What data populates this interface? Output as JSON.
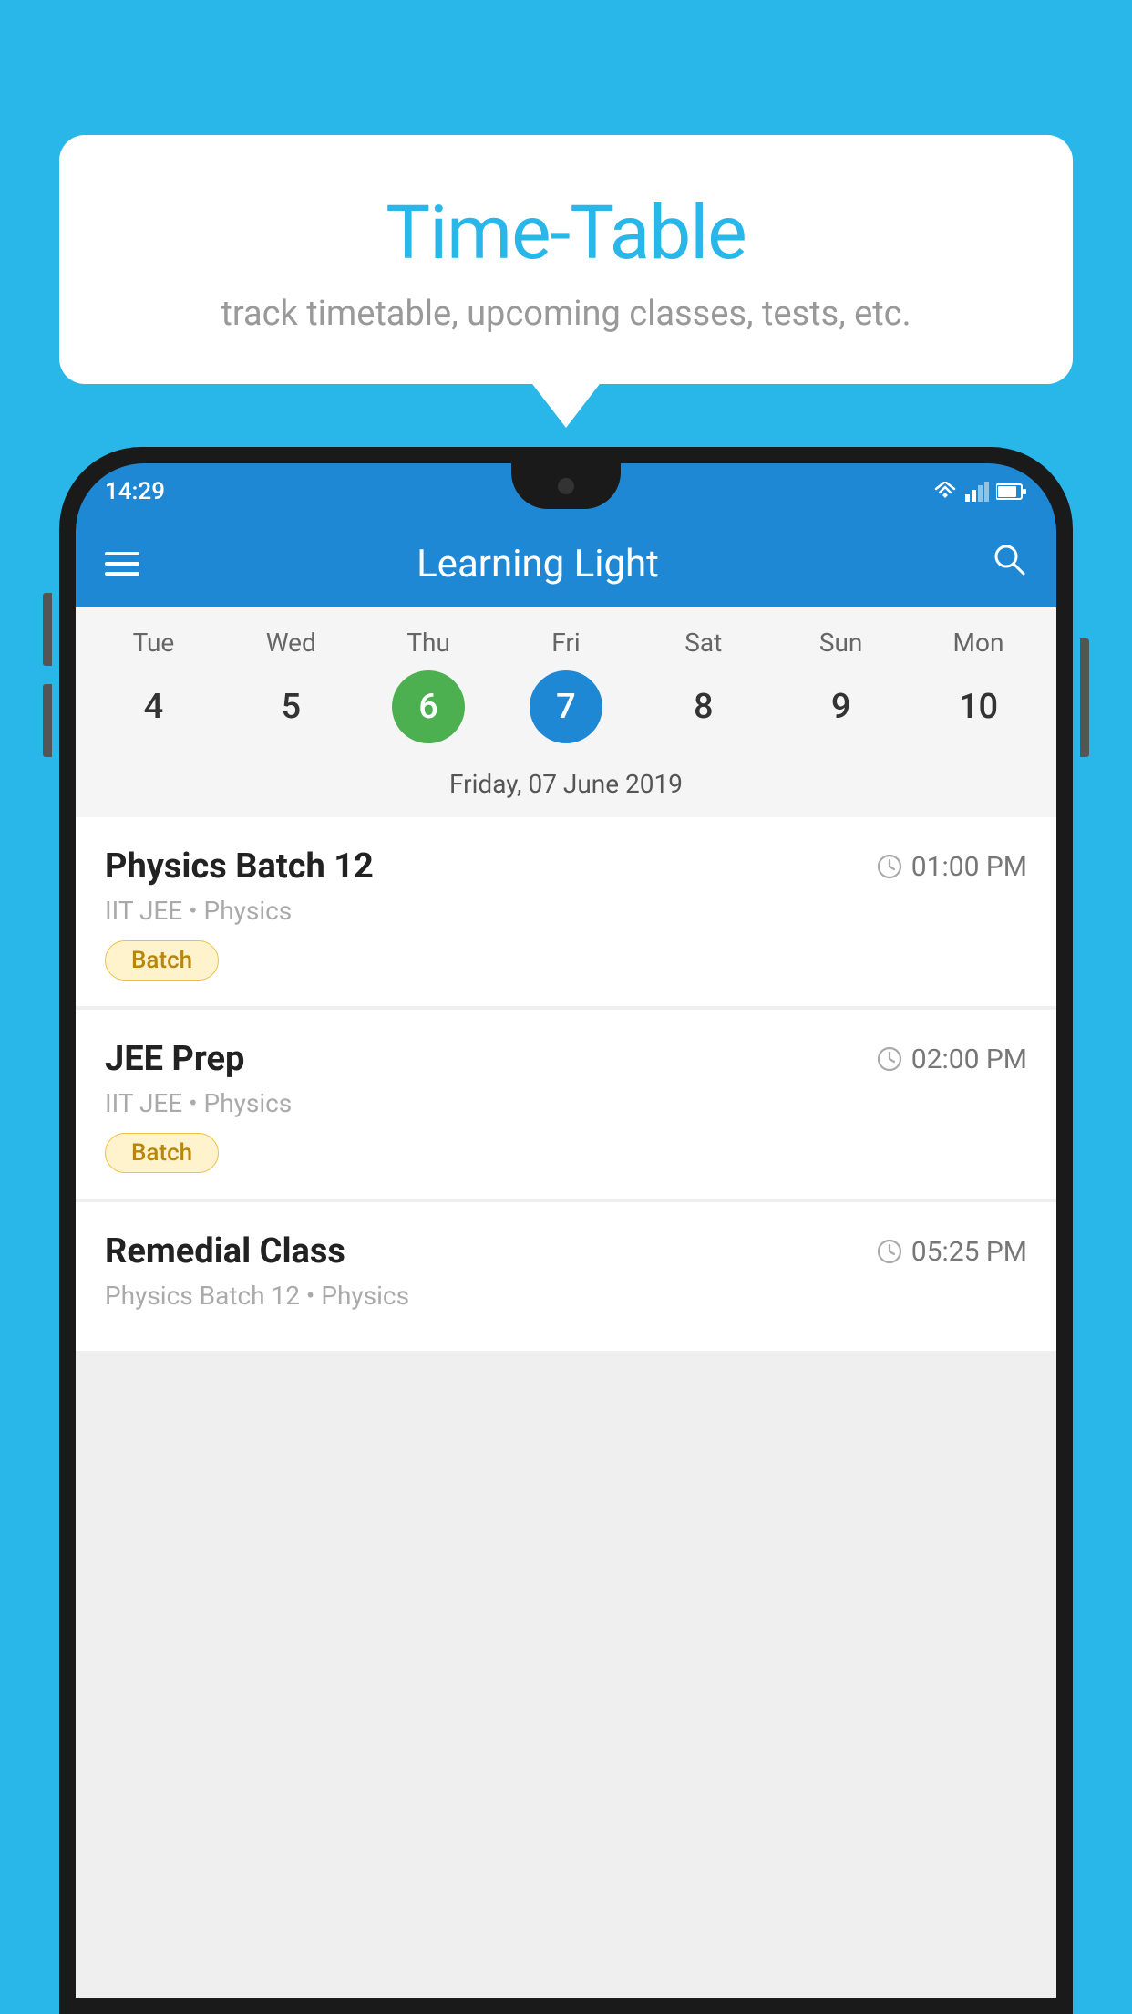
{
  "background_color": "#29b6e8",
  "tooltip": {
    "title": "Time-Table",
    "subtitle": "track timetable, upcoming classes, tests, etc."
  },
  "phone": {
    "status_bar": {
      "time": "14:29",
      "icons": [
        "wifi",
        "signal",
        "battery"
      ]
    },
    "app_bar": {
      "title": "Learning Light",
      "menu_icon": "hamburger-icon",
      "search_icon": "search-icon"
    },
    "calendar": {
      "days": [
        {
          "label": "Tue",
          "num": "4"
        },
        {
          "label": "Wed",
          "num": "5"
        },
        {
          "label": "Thu",
          "num": "6",
          "state": "today"
        },
        {
          "label": "Fri",
          "num": "7",
          "state": "selected"
        },
        {
          "label": "Sat",
          "num": "8"
        },
        {
          "label": "Sun",
          "num": "9"
        },
        {
          "label": "Mon",
          "num": "10"
        }
      ],
      "selected_date_label": "Friday, 07 June 2019"
    },
    "classes": [
      {
        "title": "Physics Batch 12",
        "time": "01:00 PM",
        "subtitle": "IIT JEE • Physics",
        "badge": "Batch"
      },
      {
        "title": "JEE Prep",
        "time": "02:00 PM",
        "subtitle": "IIT JEE • Physics",
        "badge": "Batch"
      },
      {
        "title": "Remedial Class",
        "time": "05:25 PM",
        "subtitle": "Physics Batch 12 • Physics",
        "badge": ""
      }
    ]
  }
}
